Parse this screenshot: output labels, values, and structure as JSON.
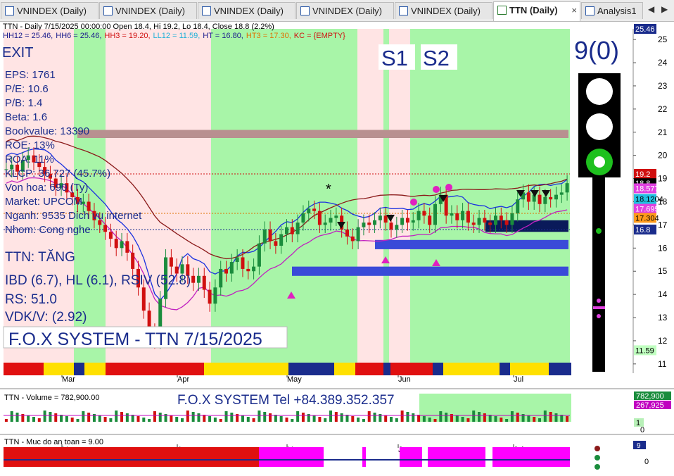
{
  "tabs": [
    {
      "label": "VNINDEX (Daily)",
      "active": false
    },
    {
      "label": "VNINDEX (Daily)",
      "active": false
    },
    {
      "label": "VNINDEX (Daily)",
      "active": false
    },
    {
      "label": "VNINDEX (Daily)",
      "active": false
    },
    {
      "label": "VNINDEX (Daily)",
      "active": false
    },
    {
      "label": "TTN (Daily)",
      "active": true
    },
    {
      "label": "Analysis1",
      "active": false
    }
  ],
  "tab_close": "×",
  "nav_left": "◀",
  "nav_right": "▶",
  "header": {
    "line1": "TTN - Daily 7/15/2025 00:00:00 Open 18.4, Hi 19.2, Lo 18.4, Close 18.8 (2.2%)",
    "line2": [
      {
        "text": "HH12 = 25.46,",
        "color": "#1a1a8c"
      },
      {
        "text": "HH6 = 25.46,",
        "color": "#1a1a8c"
      },
      {
        "text": "HH3 = 19.20,",
        "color": "#d01010"
      },
      {
        "text": "LL12 = 11.59,",
        "color": "#20b0d8"
      },
      {
        "text": "HT = 16.80,",
        "color": "#1a1a8c"
      },
      {
        "text": "HT3 = 17.30,",
        "color": "#e07000"
      },
      {
        "text": "KC = {EMPTY}",
        "color": "#d01010"
      }
    ]
  },
  "left_panel": {
    "exit": "EXIT",
    "stats": [
      "EPS: 1761",
      "P/E: 10.6",
      "P/B: 1.4",
      "Beta: 1.6",
      "Bookvalue: 13390",
      "ROE: 13%",
      "ROA: 11%",
      "KLCP: 36.727 (45.7%)",
      "Von hoa: 690 (Ty)",
      "Market: UPCOM",
      "Nganh: 9535 Dich vu internet",
      "Nhom: Cong nghe"
    ],
    "signal": "TTN: TĂNG",
    "ibd": "IBD (6.7), HL (6.1), RSIV (52.8)",
    "rs": "RS: 51.0",
    "vdk": "VDK/V:  (2.92)",
    "banner": "F.O.X SYSTEM - TTN 7/15/2025"
  },
  "overlay": {
    "s1": "S1",
    "s2": "S2",
    "count": "9(0)",
    "star": "*"
  },
  "price_axis": {
    "ticks": [
      "25",
      "24",
      "23",
      "22",
      "21",
      "20",
      "19",
      "18",
      "17",
      "16",
      "15",
      "14",
      "13",
      "12",
      "11"
    ],
    "tags": [
      {
        "text": "25.46",
        "price": 25.46,
        "bg": "#1a2c8c",
        "fg": "#ffffff"
      },
      {
        "text": "19.2",
        "price": 19.2,
        "bg": "#d01010",
        "fg": "#ffffff"
      },
      {
        "text": "18.8",
        "price": 18.8,
        "bg": "#000000",
        "fg": "#ffffff"
      },
      {
        "text": "18.5774",
        "price": 18.5774,
        "bg": "#e040e0",
        "fg": "#ffffff"
      },
      {
        "text": "18.1204",
        "price": 18.1204,
        "bg": "#20c0e0",
        "fg": "#000000"
      },
      {
        "text": "17.695",
        "price": 17.695,
        "bg": "#e040e0",
        "fg": "#ffffff"
      },
      {
        "text": "17.304",
        "price": 17.304,
        "bg": "#ff9a1a",
        "fg": "#000000"
      },
      {
        "text": "16.8",
        "price": 16.8,
        "bg": "#1a2c8c",
        "fg": "#ffffff"
      },
      {
        "text": "11.59",
        "price": 11.59,
        "bg": "#c0ffc0",
        "fg": "#000000"
      }
    ]
  },
  "months": [
    "Mar",
    "Apr",
    "May",
    "Jun",
    "Jul"
  ],
  "volume_pane": {
    "title": "TTN - Volume = 782,900.00",
    "contact": "F.O.X SYSTEM Tel +84.389.352.357",
    "tags": [
      {
        "text": "782,900",
        "bg": "#1a8c3c",
        "fg": "#ffffff"
      },
      {
        "text": "267,925",
        "bg": "#c000c0",
        "fg": "#ffffff"
      },
      {
        "text": "1",
        "bg": "#b8f0b8",
        "fg": "#000000"
      }
    ],
    "axis_zero": "0"
  },
  "safety_pane": {
    "title": "TTN - Muc do an toan = 9.00",
    "tag": "9",
    "axis_zero": "0"
  },
  "chart_data": {
    "type": "candlestick",
    "period": "Daily",
    "symbol": "TTN",
    "ylim": [
      10.6,
      25.46
    ],
    "ohlc_last": {
      "open": 18.4,
      "high": 19.2,
      "low": 18.4,
      "close": 18.8,
      "change_pct": 2.2
    },
    "closes": [
      19.4,
      19.6,
      19.3,
      19.8,
      20.0,
      19.7,
      19.5,
      19.2,
      19.0,
      18.6,
      18.8,
      18.4,
      18.2,
      17.9,
      18.0,
      17.6,
      17.2,
      17.0,
      16.7,
      16.4,
      16.0,
      16.3,
      15.8,
      15.1,
      14.3,
      13.3,
      12.4,
      12.0,
      13.8,
      15.6,
      15.2,
      14.9,
      15.3,
      14.8,
      14.5,
      14.8,
      14.2,
      13.6,
      14.3,
      15.1,
      14.9,
      15.4,
      15.6,
      15.1,
      15.0,
      15.2,
      16.2,
      16.8,
      16.3,
      16.1,
      16.6,
      16.9,
      16.6,
      17.1,
      17.5,
      17.7,
      17.6,
      17.0,
      17.1,
      17.3,
      17.4,
      16.8,
      16.5,
      16.3,
      16.9,
      17.1,
      17.0,
      17.2,
      17.4,
      17.1,
      16.8,
      17.0,
      17.3,
      17.1,
      17.2,
      17.6,
      17.4,
      17.0,
      17.9,
      18.3,
      17.4,
      17.5,
      17.2,
      17.6,
      17.1,
      17.0,
      17.3,
      17.1,
      17.0,
      17.4,
      17.2,
      17.0,
      17.5,
      18.1,
      18.4,
      18.0,
      18.3,
      17.9,
      18.2,
      18.1,
      18.3,
      18.4,
      18.8
    ],
    "bookvalue_band": [
      20.75,
      21.1
    ],
    "support_bands": [
      [
        16.7,
        17.2
      ],
      [
        15.95,
        16.35
      ],
      [
        14.8,
        15.2
      ]
    ],
    "dotted_lines": [
      {
        "price": 17.5,
        "color": "#e07000"
      },
      {
        "price": 16.8,
        "color": "#1a2c8c"
      },
      {
        "price": 19.2,
        "color": "#d01010"
      }
    ],
    "volume_last": 782900,
    "volume_ma": 267925,
    "safety_level": 9
  }
}
